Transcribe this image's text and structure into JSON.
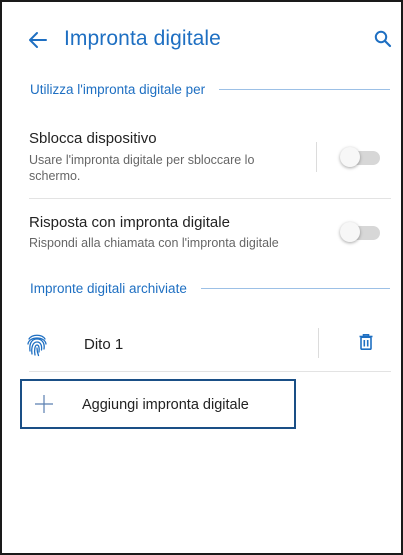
{
  "header": {
    "back_icon": "arrow-left-icon",
    "title": "Impronta digitale",
    "search_icon": "search-icon"
  },
  "section_use": {
    "label": "Utilizza l'impronta digitale per"
  },
  "unlock_row": {
    "title": "Sblocca dispositivo",
    "subtitle": "Usare l'impronta digitale per sbloccare lo schermo.",
    "toggle_on": false
  },
  "answer_row": {
    "title": "Risposta con impronta digitale",
    "subtitle": "Rispondi alla chiamata con l'impronta digitale",
    "toggle_on": false
  },
  "section_stored": {
    "label": "Impronte digitali archiviate"
  },
  "fingerprints": [
    {
      "name": "Dito 1",
      "icon": "fingerprint-icon",
      "delete_icon": "trash-icon"
    }
  ],
  "add_button": {
    "label": "Aggiungi impronta digitale",
    "icon": "plus-icon"
  },
  "colors": {
    "accent": "#1e6fc2",
    "focus_border": "#1a4f86"
  }
}
